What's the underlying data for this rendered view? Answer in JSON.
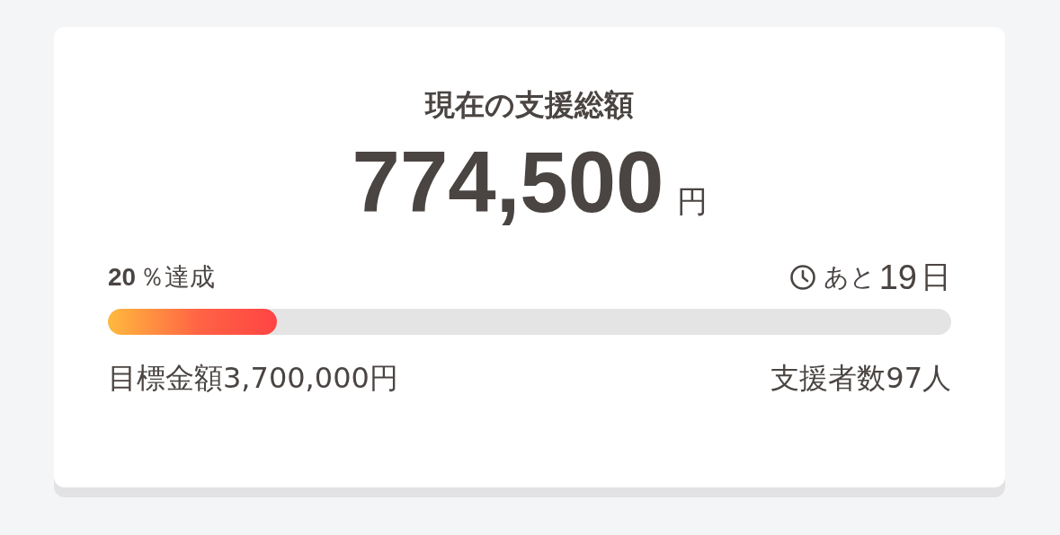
{
  "card": {
    "title": "現在の支援総額",
    "amount": "774,500",
    "amount_unit": "円",
    "achievement": {
      "percent": "20",
      "label": "％達成"
    },
    "remaining": {
      "prefix": "あと",
      "number": "19",
      "unit": "日"
    },
    "progress": {
      "level": 0.2
    },
    "goal": "目標金額3,700,000円",
    "backers": "支援者数97人"
  }
}
